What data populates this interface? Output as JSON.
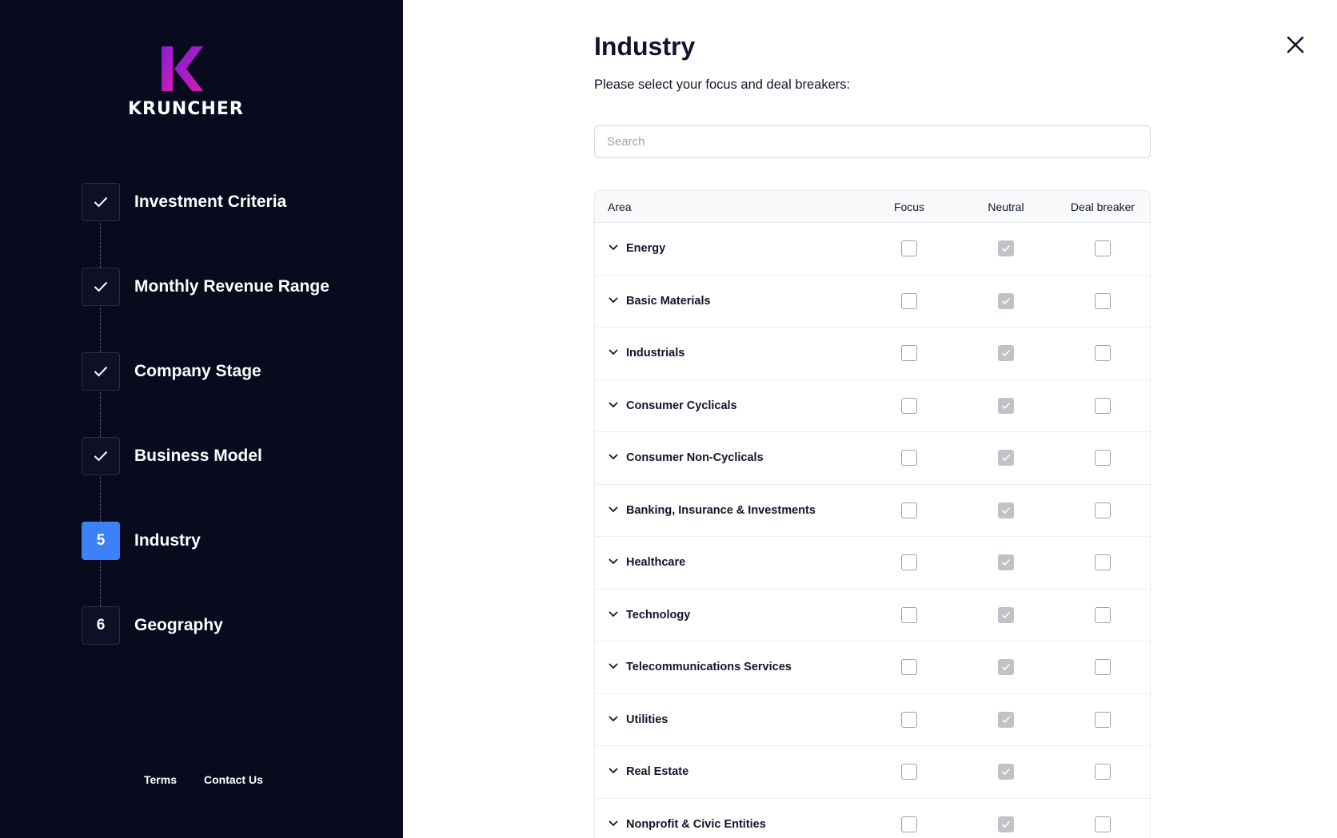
{
  "brand": {
    "name": "KRUNCHER",
    "gradient_from": "#7c1fd6",
    "gradient_to": "#d81bb0"
  },
  "steps": [
    {
      "label": "Investment Criteria",
      "status": "completed",
      "number": "1"
    },
    {
      "label": "Monthly Revenue Range",
      "status": "completed",
      "number": "2"
    },
    {
      "label": "Company Stage",
      "status": "completed",
      "number": "3"
    },
    {
      "label": "Business Model",
      "status": "completed",
      "number": "4"
    },
    {
      "label": "Industry",
      "status": "active",
      "number": "5"
    },
    {
      "label": "Geography",
      "status": "pending",
      "number": "6"
    }
  ],
  "footer": {
    "terms": "Terms",
    "contact": "Contact Us"
  },
  "main": {
    "title": "Industry",
    "subtitle": "Please select your focus and deal breakers:",
    "search_placeholder": "Search",
    "search_value": ""
  },
  "table": {
    "headers": {
      "area": "Area",
      "focus": "Focus",
      "neutral": "Neutral",
      "deal": "Deal breaker"
    },
    "rows": [
      {
        "label": "Energy",
        "selection": "neutral"
      },
      {
        "label": "Basic Materials",
        "selection": "neutral"
      },
      {
        "label": "Industrials",
        "selection": "neutral"
      },
      {
        "label": "Consumer Cyclicals",
        "selection": "neutral"
      },
      {
        "label": "Consumer Non-Cyclicals",
        "selection": "neutral"
      },
      {
        "label": "Banking, Insurance & Investments",
        "selection": "neutral"
      },
      {
        "label": "Healthcare",
        "selection": "neutral"
      },
      {
        "label": "Technology",
        "selection": "neutral"
      },
      {
        "label": "Telecommunications Services",
        "selection": "neutral"
      },
      {
        "label": "Utilities",
        "selection": "neutral"
      },
      {
        "label": "Real Estate",
        "selection": "neutral"
      },
      {
        "label": "Nonprofit & Civic Entities",
        "selection": "neutral"
      }
    ]
  },
  "colors": {
    "sidebar_bg": "#080a1e",
    "active_step": "#3b82f6",
    "checked_box": "#bfc2c7",
    "text_dark": "#10152b"
  }
}
